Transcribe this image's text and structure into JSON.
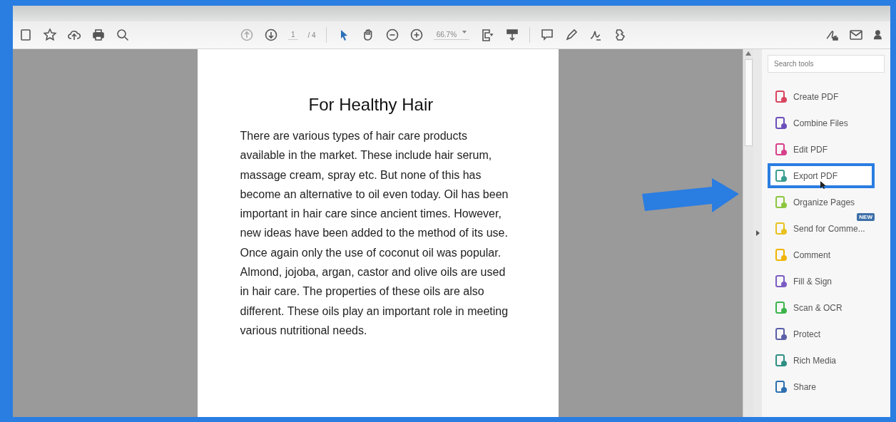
{
  "toolbar": {
    "page_number": "1",
    "page_count": "/ 4",
    "zoom": "66.7%"
  },
  "document": {
    "title": "For Healthy Hair",
    "body": "There are various types of hair care products available in the market. These include hair serum, massage cream, spray etc. But none of this has become an alternative to oil even today. Oil has been important in hair care since ancient times. However, new ideas have been added to the method of its use. Once again only the use of coconut oil was popular. Almond, jojoba, argan, castor and olive oils are used in hair care. The properties of these oils are also different. These oils play an important role in meeting various nutritional needs."
  },
  "tools_panel": {
    "search": {
      "placeholder": "Search tools"
    },
    "items": [
      {
        "label": "Create PDF",
        "color": "#d9455f",
        "selected": false
      },
      {
        "label": "Combine Files",
        "color": "#6b4fbb",
        "selected": false
      },
      {
        "label": "Edit PDF",
        "color": "#d6408a",
        "selected": false
      },
      {
        "label": "Export PDF",
        "color": "#3a9d8f",
        "selected": true
      },
      {
        "label": "Organize Pages",
        "color": "#8cc63f",
        "selected": false
      },
      {
        "label": "Send for Comme...",
        "color": "#e8c21e",
        "selected": false,
        "badge": "NEW"
      },
      {
        "label": "Comment",
        "color": "#f0b400",
        "selected": false
      },
      {
        "label": "Fill & Sign",
        "color": "#7b5cc4",
        "selected": false
      },
      {
        "label": "Scan & OCR",
        "color": "#3cb44b",
        "selected": false
      },
      {
        "label": "Protect",
        "color": "#5a5fa8",
        "selected": false
      },
      {
        "label": "Rich Media",
        "color": "#2f8f83",
        "selected": false
      },
      {
        "label": "Share",
        "color": "#2d6fb0",
        "selected": false
      }
    ]
  }
}
